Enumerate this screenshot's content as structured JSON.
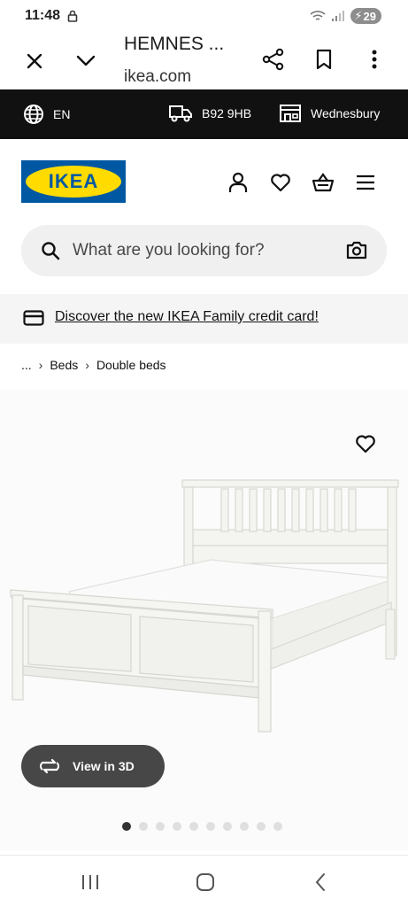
{
  "status": {
    "time": "11:48",
    "battery": "29"
  },
  "browser": {
    "title": "HEMNES ...",
    "url": "ikea.com"
  },
  "info_bar": {
    "language": "EN",
    "postcode": "B92 9HB",
    "store": "Wednesbury"
  },
  "header": {
    "logo_text": "IKEA",
    "brand_colors": {
      "blue": "#0058a3",
      "yellow": "#ffdb00"
    }
  },
  "search": {
    "placeholder": "What are you looking for?"
  },
  "promo": {
    "text": "Discover the new IKEA Family credit card!"
  },
  "breadcrumb": {
    "items": [
      "...",
      "Beds",
      "Double beds"
    ]
  },
  "product": {
    "view_3d_label": "View in 3D",
    "carousel": {
      "total": 10,
      "active": 1
    }
  },
  "icons": {
    "browser": [
      "close-icon",
      "chevron-down-icon",
      "share-icon",
      "bookmark-icon",
      "more-vertical-icon"
    ],
    "info_bar": [
      "globe-icon",
      "delivery-truck-icon",
      "store-icon"
    ],
    "header": [
      "user-icon",
      "heart-icon",
      "basket-icon",
      "menu-icon"
    ],
    "nav": [
      "recent-apps-icon",
      "home-icon",
      "back-icon"
    ]
  }
}
